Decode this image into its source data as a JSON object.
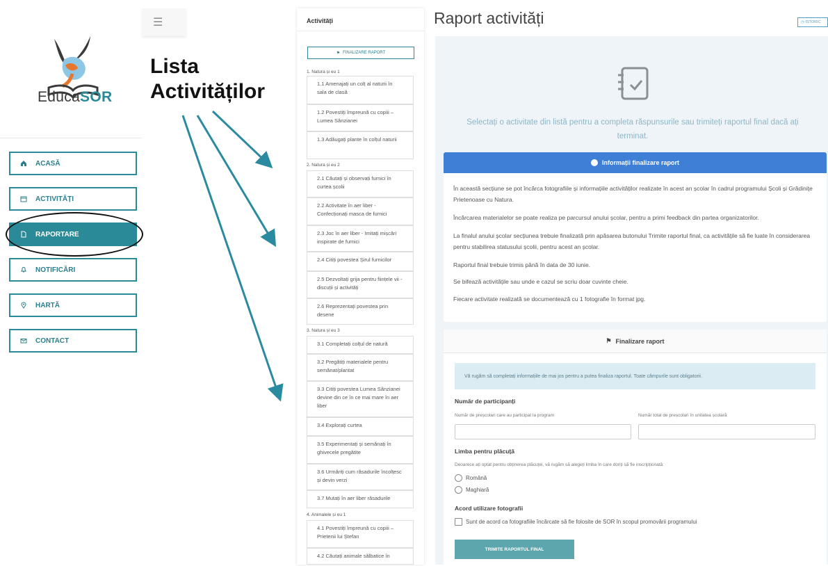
{
  "logo": {
    "brand_left": "Educa",
    "brand_right": "SOR"
  },
  "nav": [
    {
      "label": "ACASĂ",
      "icon": "home-icon"
    },
    {
      "label": "ACTIVITĂȚI",
      "icon": "calendar-icon"
    },
    {
      "label": "RAPORTARE",
      "icon": "document-icon",
      "active": true
    },
    {
      "label": "NOTIFICĂRI",
      "icon": "bell-icon"
    },
    {
      "label": "HARTĂ",
      "icon": "map-pin-icon"
    },
    {
      "label": "CONTACT",
      "icon": "mail-icon"
    }
  ],
  "annotation": {
    "line1": "Lista",
    "line2": "Activităților"
  },
  "list": {
    "title": "Activități",
    "final_button": "FINALIZARE RAPORT",
    "groups": [
      {
        "label": "1. Natura și eu 1"
      },
      {
        "label": "2. Natura și eu 2"
      },
      {
        "label": "3. Natura și eu 3"
      },
      {
        "label": "4. Animalele și eu 1"
      }
    ],
    "items": [
      "1.1 Amenajați un colț al naturii în sala de clasă",
      "1.2 Povestiți împreună cu copiii – Lumea Sânzianei",
      "1.3 Adăugați plante în colțul naturii",
      "2.1 Căutați și observați furnici în curtea școlii",
      "2.2 Activitate în aer liber - Confecționați masca de furnici",
      "2.3 Joc în aer liber - Imitați mișcări inspirate de furnici",
      "2.4 Citiți povestea Șirul furnicilor",
      "2.5 Dezvoltați grija pentru ființele vii - discuții și activități",
      "2.6 Reprezentați povestea prin desene",
      "3.1 Completați colțul de natură",
      "3.2 Pregătiți materialele pentru semănat/plantat",
      "3.3 Citiți povestea Lumea Sânzianei devine din ce în ce mai mare în aer liber",
      "3.4 Explorați curtea",
      "3.5 Experimentați și semănați în ghivecele pregătite",
      "3.6 Urmăriți cum răsadurile încolțesc și devin verzi",
      "3.7 Mutați în aer liber răsadurile",
      "4.1 Povestiți împreună cu copiii – Prietenii lui Ștefan",
      "4.2 Căutați animale sălbatice în"
    ]
  },
  "main": {
    "title": "Raport activități",
    "istoric": "ISTORIC",
    "select_text": "Selectați o activitate din listă pentru a completa răspunsurile sau trimiteți raportul final dacă ați terminat.",
    "info_title": "Informații finalizare raport",
    "info_paragraphs": [
      "În această secțiune se pot încărca fotografiile și informațiile activităților realizate în acest an școlar în cadrul programului Școli și Grădinițe Prietenoase cu Natura.",
      "Încărcarea materialelor se poate realiza pe parcursul anului școlar, pentru a primi feedback din partea organizatorilor.",
      "La finalul anului școlar secțiunea trebuie finalizată prin apăsarea butonului Trimite raportul final, ca activitățile să fie luate în considerarea pentru stabilirea statusului școlii, pentru acest an școlar.",
      "Raportul final trebuie trimis până în data de 30 iunie.",
      "Se bifează activitățile sau unde e cazul se scriu doar cuvinte cheie.",
      "Fiecare activitate realizată se documentează cu 1 fotografie în format jpg."
    ],
    "fin_title": "Finalizare raport",
    "fin_alert": "Vă rugăm să completați informațiile de mai jos pentru a putea finaliza raportul. Toate câmpurile sunt obligatorii.",
    "participants_label": "Număr de participanți",
    "participants_sub1": "Număr de preșcolari care au participat la program",
    "participants_sub2": "Număr total de preșcolari în unitatea școlară",
    "plate_label": "Limba pentru plăcuță",
    "plate_sub": "Deoarece ați optat pentru obținerea plăcuței, vă rugăm să alegeți limba în care doriți să fie inscripționată:",
    "lang1": "Română",
    "lang2": "Maghiară",
    "photo_label": "Acord utilizare fotografii",
    "photo_consent": "Sunt de acord ca fotografiile încărcate să fie folosite de SOR în scopul promovării programului",
    "send_button": "TRIMITE RAPORTUL FINAL"
  }
}
